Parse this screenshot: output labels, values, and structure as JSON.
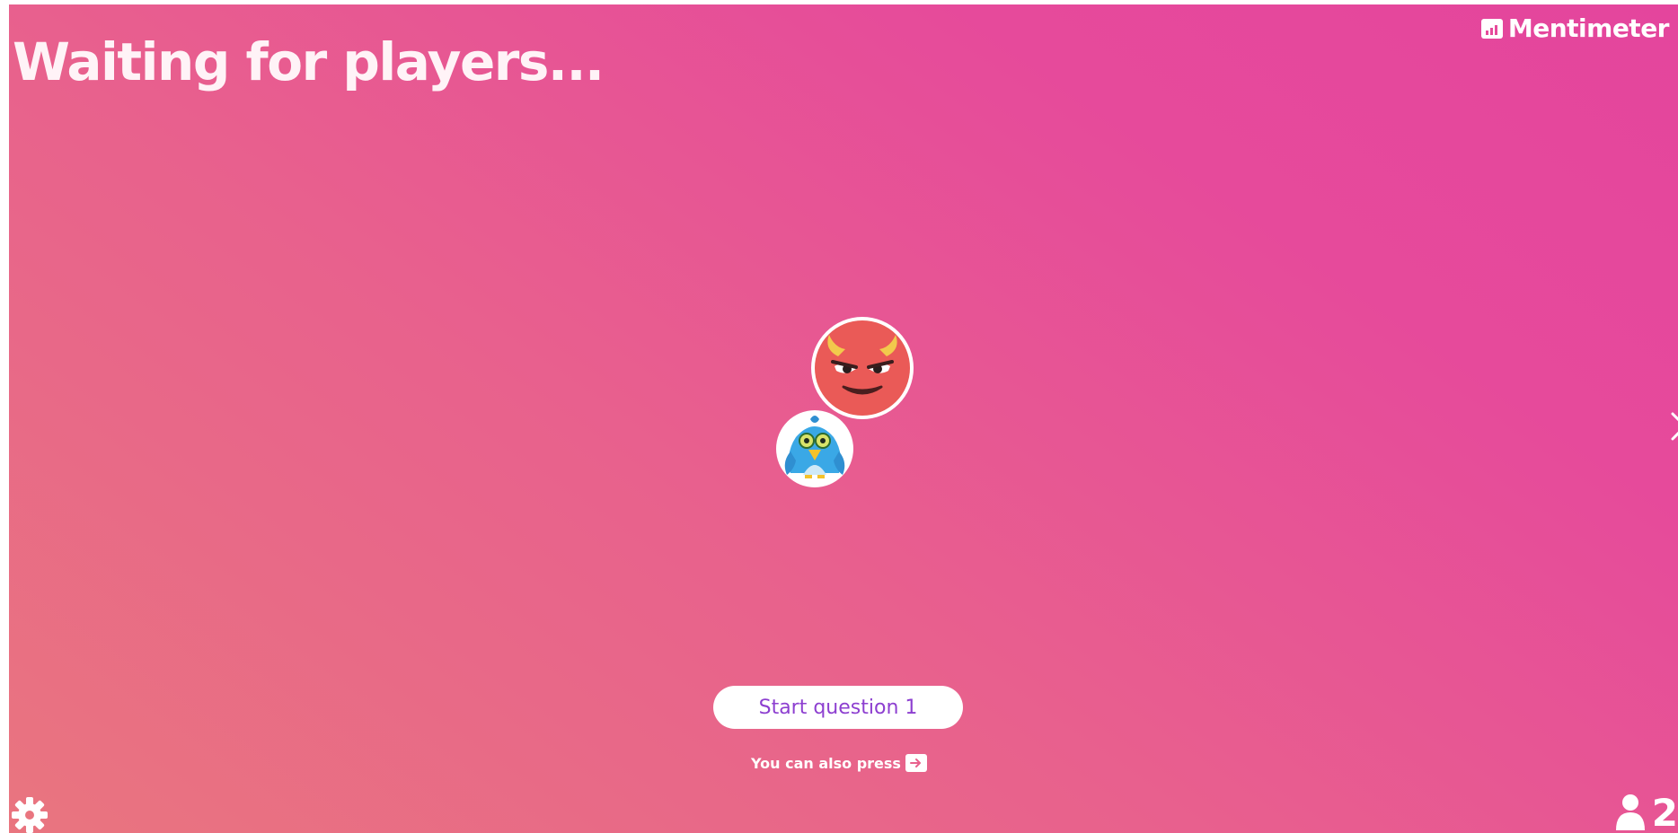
{
  "header": {
    "title": "Waiting for players...",
    "brand_name": "Mentimeter",
    "brand_icon": "bar-chart-icon"
  },
  "players": {
    "avatars": [
      {
        "name": "devil-avatar",
        "icon": "devil-face-icon",
        "color": "#ea5a57"
      },
      {
        "name": "bird-avatar",
        "icon": "blue-bird-icon",
        "color": "#3aa8e6"
      }
    ]
  },
  "controls": {
    "start_label": "Start question 1",
    "hint_text": "You can also press",
    "hint_key_icon": "right-arrow-key-icon",
    "next_icon": "chevron-right-icon",
    "settings_icon": "gear-icon",
    "participants_icon": "person-icon",
    "participants_count": "2"
  },
  "colors": {
    "background_start": "#e9757f",
    "background_end": "#e4459d",
    "button_text": "#8d3fd0",
    "white": "#ffffff"
  }
}
